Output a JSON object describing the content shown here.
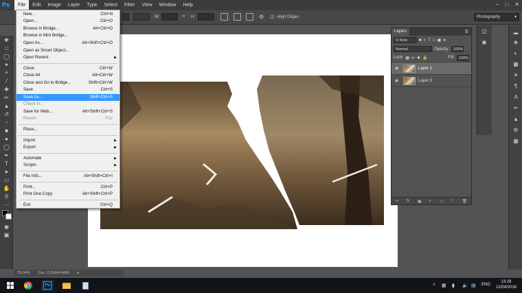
{
  "app": {
    "logo": "Ps"
  },
  "menubar": {
    "items": [
      "File",
      "Edit",
      "Image",
      "Layer",
      "Type",
      "Select",
      "Filter",
      "View",
      "Window",
      "Help"
    ],
    "active": "File"
  },
  "options": {
    "w_label": "W:",
    "h_label": "H:",
    "align_edges": "Align Edges",
    "workspace": "Photography"
  },
  "file_menu": {
    "items": [
      {
        "label": "New...",
        "shortcut": "Ctrl+N"
      },
      {
        "label": "Open...",
        "shortcut": "Ctrl+O"
      },
      {
        "label": "Browse in Bridge...",
        "shortcut": "Alt+Ctrl+O"
      },
      {
        "label": "Browse in Mini Bridge...",
        "shortcut": ""
      },
      {
        "label": "Open As...",
        "shortcut": "Alt+Shift+Ctrl+O"
      },
      {
        "label": "Open as Smart Object...",
        "shortcut": ""
      },
      {
        "label": "Open Recent",
        "shortcut": ""
      },
      {
        "label": "Close",
        "shortcut": "Ctrl+W"
      },
      {
        "label": "Close All",
        "shortcut": "Alt+Ctrl+W"
      },
      {
        "label": "Close and Go to Bridge...",
        "shortcut": "Shift+Ctrl+W"
      },
      {
        "label": "Save",
        "shortcut": "Ctrl+S"
      },
      {
        "label": "Save As...",
        "shortcut": "Shift+Ctrl+S"
      },
      {
        "label": "Check In...",
        "shortcut": ""
      },
      {
        "label": "Save for Web...",
        "shortcut": "Alt+Shift+Ctrl+S"
      },
      {
        "label": "Revert",
        "shortcut": "F12"
      },
      {
        "label": "Place...",
        "shortcut": ""
      },
      {
        "label": "Import",
        "shortcut": ""
      },
      {
        "label": "Export",
        "shortcut": ""
      },
      {
        "label": "Automate",
        "shortcut": ""
      },
      {
        "label": "Scripts",
        "shortcut": ""
      },
      {
        "label": "File Info...",
        "shortcut": "Alt+Shift+Ctrl+I"
      },
      {
        "label": "Print...",
        "shortcut": "Ctrl+P"
      },
      {
        "label": "Print One Copy",
        "shortcut": "Alt+Shift+Ctrl+P"
      },
      {
        "label": "Exit",
        "shortcut": "Ctrl+Q"
      }
    ]
  },
  "layers_panel": {
    "tab": "Layers",
    "kind": "Kind",
    "blend_mode": "Normal",
    "opacity_label": "Opacity:",
    "opacity_value": "100%",
    "lock_label": "Lock:",
    "fill_label": "Fill:",
    "fill_value": "100%",
    "layers": [
      {
        "name": "Layer 1",
        "selected": true
      },
      {
        "name": "Layer 0",
        "selected": false
      }
    ]
  },
  "status": {
    "zoom": "79.04%",
    "doc": "Doc: 2.25M/4.46M"
  },
  "taskbar": {
    "lang": "ENG",
    "time": "13:28",
    "date": "12/04/2016"
  },
  "colors": {
    "highlight": "#3399ff",
    "menubar": "#3c3c3c",
    "panel": "#535353"
  }
}
